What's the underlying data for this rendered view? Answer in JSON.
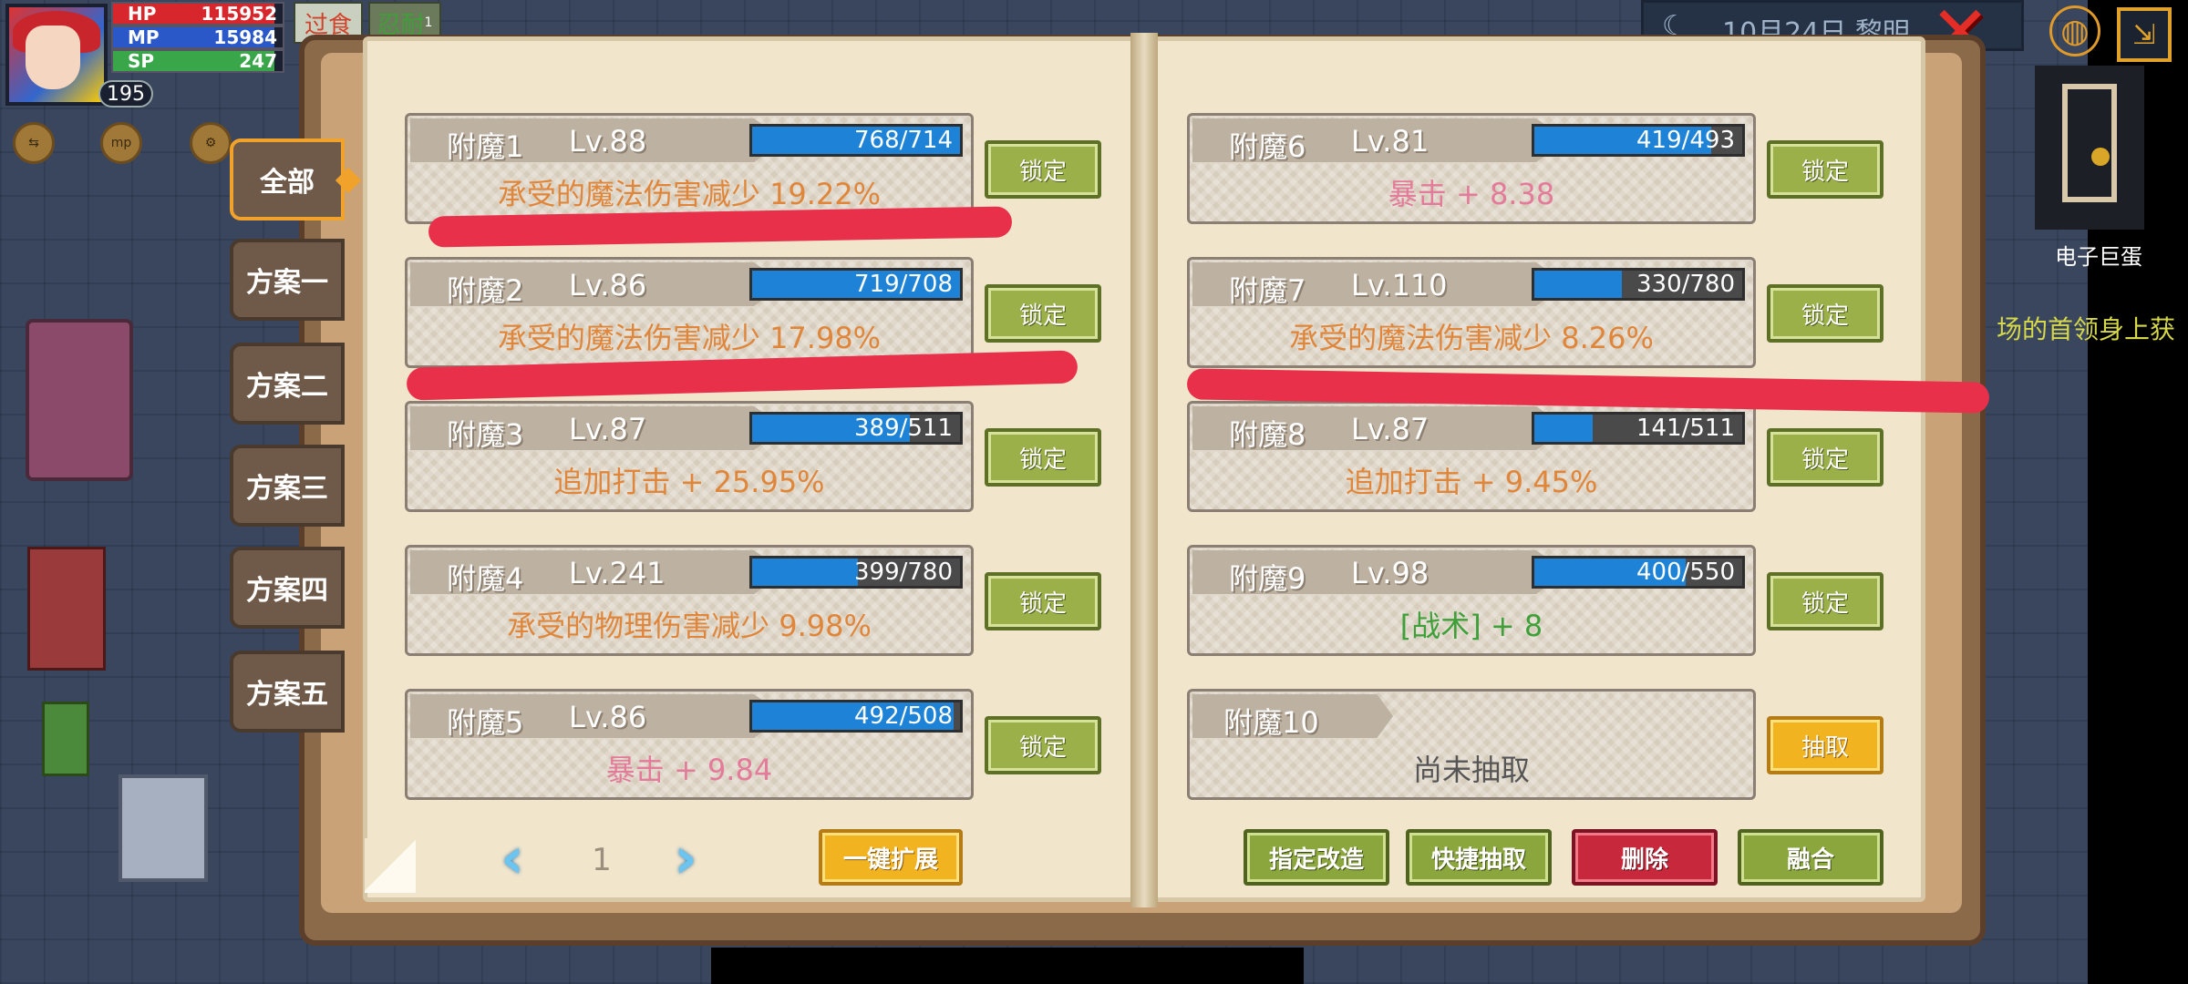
{
  "player": {
    "level": "195"
  },
  "stats": [
    {
      "label": "HP",
      "value": "115952",
      "fill": 0.95,
      "color": "#d7262c"
    },
    {
      "label": "MP",
      "value": "15984",
      "fill": 0.95,
      "color": "#2a58c8"
    },
    {
      "label": "SP",
      "value": "247",
      "fill": 0.95,
      "color": "#3aa64a"
    }
  ],
  "status_tabs": {
    "tab1": "过食",
    "tab2": "忍耐",
    "tab2_badge": "1"
  },
  "hud_icons": {
    "icon2": "mp"
  },
  "clock": "10月24日 黎明",
  "minimap_label": "电子巨蛋",
  "quest_text": "场的首领身上获",
  "side_tabs": [
    "全部",
    "方案一",
    "方案二",
    "方案三",
    "方案四",
    "方案五"
  ],
  "enchants": [
    {
      "name": "附魔1",
      "level": "Lv.88",
      "xp": "768/714",
      "fill": 1.0,
      "effect": "承受的魔法伤害减少 19.22%",
      "lock_label": "锁定"
    },
    {
      "name": "附魔2",
      "level": "Lv.86",
      "xp": "719/708",
      "fill": 1.0,
      "effect": "承受的魔法伤害减少 17.98%",
      "lock_label": "锁定"
    },
    {
      "name": "附魔3",
      "level": "Lv.87",
      "xp": "389/511",
      "fill": 0.76,
      "effect": "追加打击 + 25.95%",
      "lock_label": "锁定"
    },
    {
      "name": "附魔4",
      "level": "Lv.241",
      "xp": "399/780",
      "fill": 0.51,
      "effect": "承受的物理伤害减少 9.98%",
      "lock_label": "锁定"
    },
    {
      "name": "附魔5",
      "level": "Lv.86",
      "xp": "492/508",
      "fill": 0.97,
      "effect": "暴击 + 9.84",
      "lock_label": "锁定"
    },
    {
      "name": "附魔6",
      "level": "Lv.81",
      "xp": "419/493",
      "fill": 0.85,
      "effect": "暴击 + 8.38",
      "lock_label": "锁定"
    },
    {
      "name": "附魔7",
      "level": "Lv.110",
      "xp": "330/780",
      "fill": 0.42,
      "effect": "承受的魔法伤害减少 8.26%",
      "lock_label": "锁定"
    },
    {
      "name": "附魔8",
      "level": "Lv.87",
      "xp": "141/511",
      "fill": 0.28,
      "effect": "追加打击 + 9.45%",
      "lock_label": "锁定"
    },
    {
      "name": "附魔9",
      "level": "Lv.98",
      "xp": "400/550",
      "fill": 0.73,
      "effect": "[战术] + 8",
      "lock_label": "锁定"
    },
    {
      "name": "附魔10",
      "effect": "尚未抽取",
      "draw_label": "抽取"
    }
  ],
  "pager": {
    "page": "1"
  },
  "buttons": {
    "expand": "一键扩展",
    "designate": "指定改造",
    "quick_draw": "快捷抽取",
    "delete": "删除",
    "fuse": "融合"
  },
  "colors": {
    "accent": "#f1a22b",
    "lock_green": "#9cb04a",
    "delete_red": "#c7283c",
    "xp_blue": "#1e83d6",
    "annotation_red": "#e8304a"
  }
}
